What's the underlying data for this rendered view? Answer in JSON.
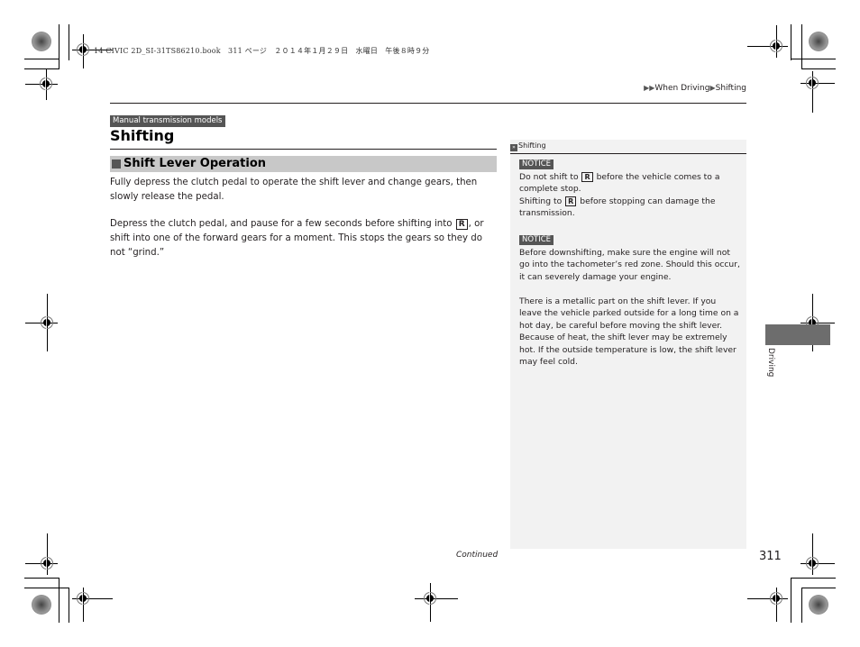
{
  "print_header": {
    "file_info": "14 CIVIC 2D_SI-31TS86210.book　311 ページ　２０１４年１月２９日　水曜日　午後８時９分"
  },
  "breadcrumb": {
    "items": [
      "When Driving",
      "Shifting"
    ],
    "separator_icon": "triangle-right-icon"
  },
  "page": {
    "model_tag": "Manual transmission models",
    "title": "Shifting",
    "section_title": "Shift Lever Operation",
    "paragraphs": [
      {
        "text": "Fully depress the clutch pedal to operate the shift lever and change gears, then slowly release the pedal."
      },
      {
        "before_key": "Depress the clutch pedal, and pause for a few seconds before shifting into ",
        "key": "R",
        "after_key": ", or shift into one of the forward gears for a moment. This stops the gears so they do not “grind.”"
      }
    ],
    "continued_label": "Continued",
    "page_number": "311"
  },
  "sidebar": {
    "header": "Shifting",
    "notice_label": "NOTICE",
    "notice1": {
      "line1_before": "Do not shift to ",
      "key": "R",
      "line1_after": " before the vehicle comes to a complete stop.",
      "line2_before": "Shifting to ",
      "line2_after": " before stopping can damage the transmission."
    },
    "notice2_text": "Before downshifting, make sure the engine will not go into the tachometer’s red zone. Should this occur, it can severely damage your engine.",
    "note_text": "There is a metallic part on the shift lever. If you leave the vehicle parked outside for a long time on a hot day, be careful before moving the shift lever. Because of heat, the shift lever may be extremely hot. If the outside temperature is low, the shift lever may feel cold."
  },
  "chapter_tab": {
    "label": "Driving",
    "color": "#6d6d6d"
  }
}
